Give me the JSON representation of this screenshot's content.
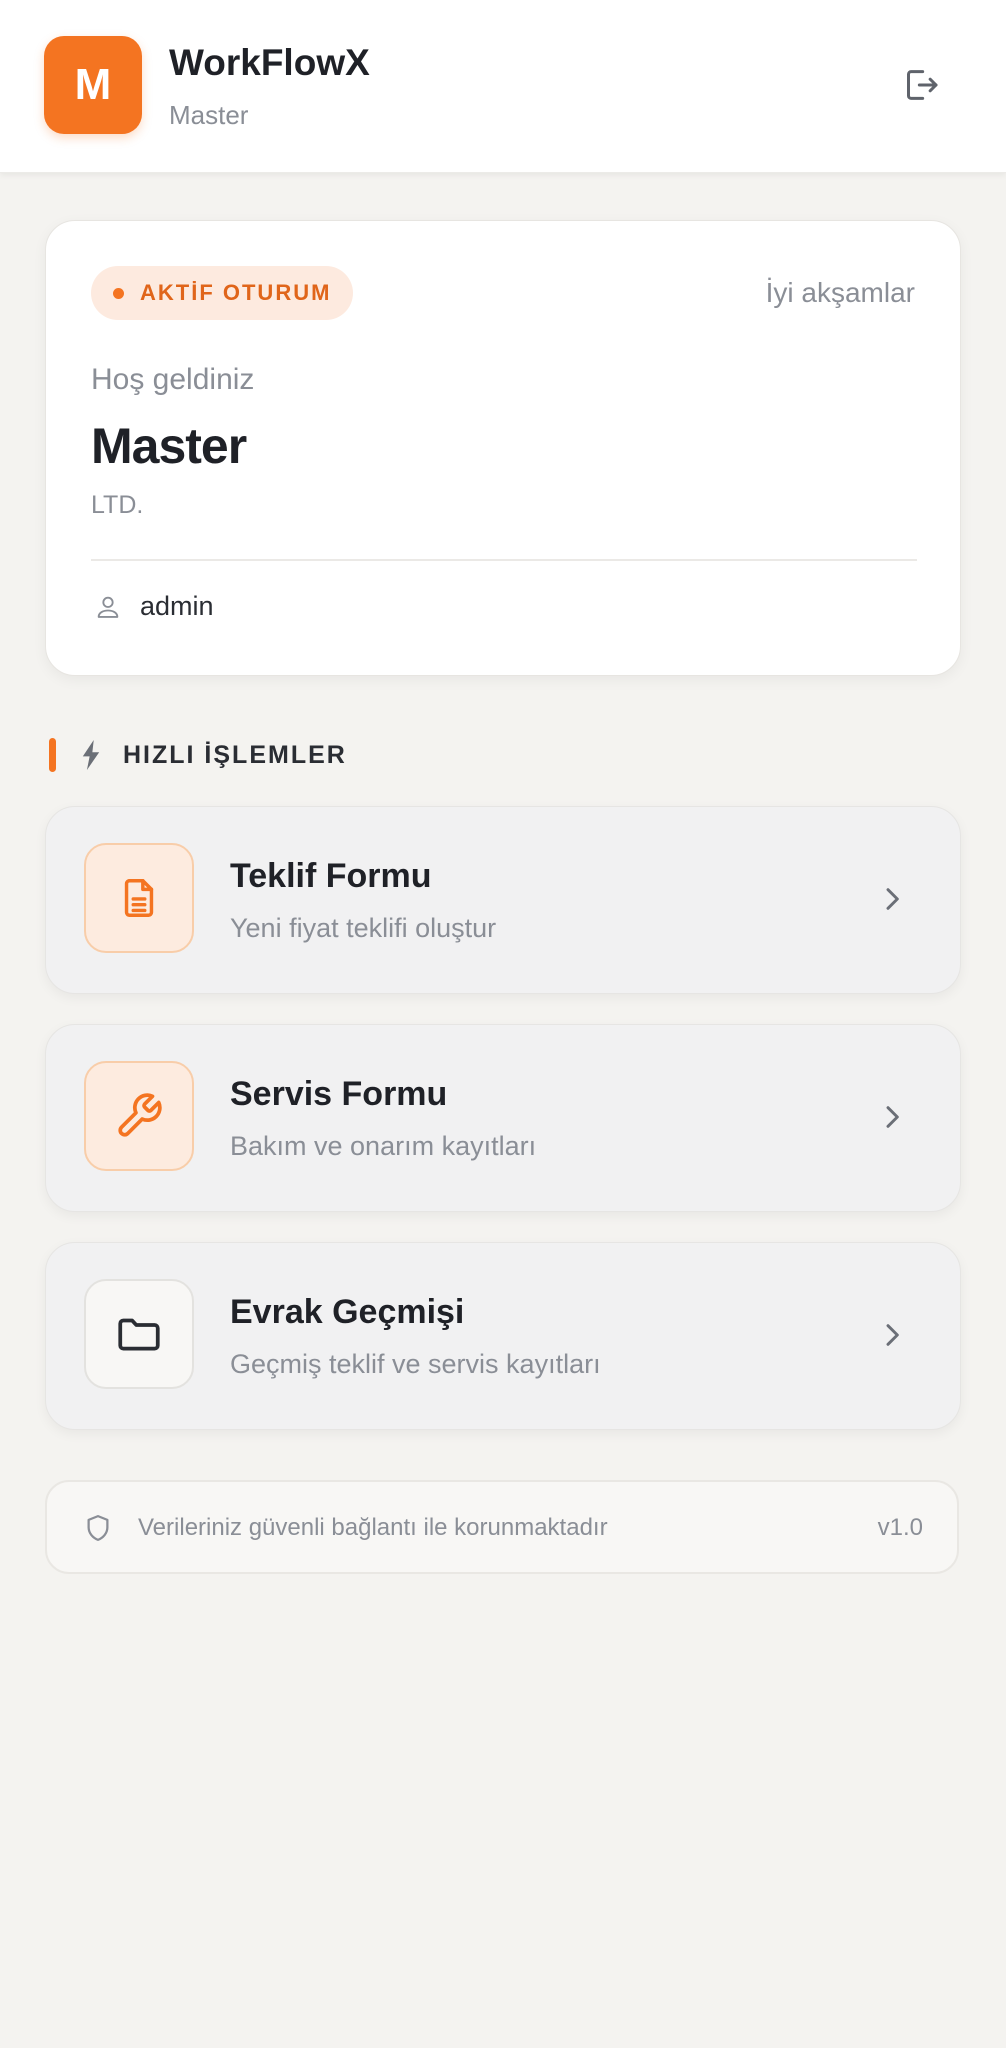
{
  "header": {
    "logo_letter": "M",
    "app_title": "WorkFlowX",
    "app_subtitle": "Master",
    "logout_icon": "logout-icon"
  },
  "welcome": {
    "session_badge": "AKTİF OTURUM",
    "greeting": "İyi akşamlar",
    "welcome_label": "Hoş geldiniz",
    "user_name": "Master",
    "company": "LTD.",
    "username": "admin",
    "user_icon": "user-icon"
  },
  "quick_actions": {
    "section_title": "HIZLI İŞLEMLER",
    "section_icon": "lightning-icon",
    "items": [
      {
        "title": "Teklif Formu",
        "description": "Yeni fiyat teklifi oluştur",
        "icon": "document-icon"
      },
      {
        "title": "Servis Formu",
        "description": "Bakım ve onarım kayıtları",
        "icon": "wrench-icon"
      },
      {
        "title": "Evrak Geçmişi",
        "description": "Geçmiş teklif ve servis kayıtları",
        "icon": "folder-icon"
      }
    ]
  },
  "footer": {
    "security_text": "Verileriniz güvenli bağlantı ile korunmaktadır",
    "version": "v1.0",
    "icon": "shield-icon"
  },
  "colors": {
    "accent": "#f47421",
    "background": "#f4f3f0",
    "card": "#ffffff",
    "text_primary": "#1f2127",
    "text_muted": "#8a8e96"
  }
}
